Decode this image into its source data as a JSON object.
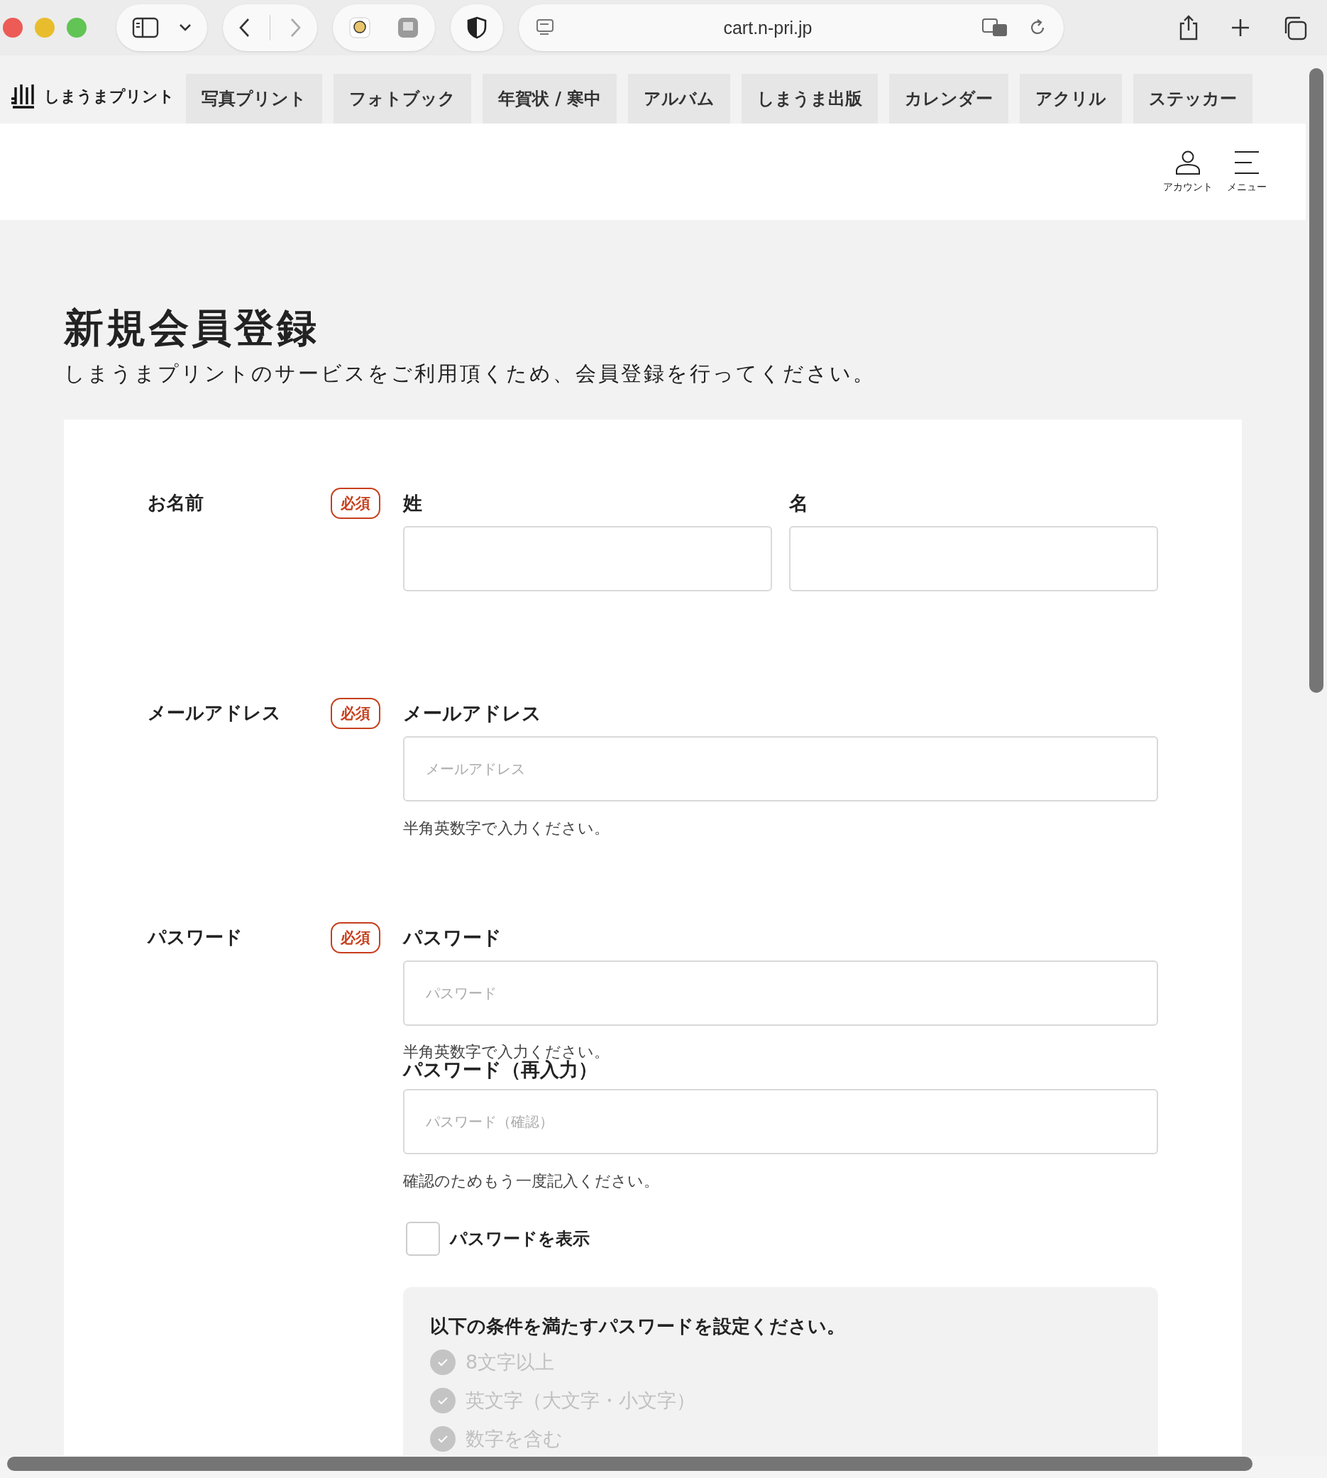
{
  "browser": {
    "url": "cart.n-pri.jp"
  },
  "site": {
    "logo": "しまうまプリント",
    "nav_tabs": [
      {
        "label": "写真プリント",
        "selected": false
      },
      {
        "label": "フォトブック",
        "selected": false
      },
      {
        "label": "年賀状 / 寒中",
        "selected": false
      },
      {
        "label": "アルバム",
        "selected": false
      },
      {
        "label": "しまうま出版",
        "selected": false
      },
      {
        "label": "カレンダー",
        "selected": false
      },
      {
        "label": "アクリル",
        "selected": false
      },
      {
        "label": "ステッカー",
        "selected": false
      }
    ],
    "header_actions": [
      {
        "kind": "account",
        "label": "アカウント"
      },
      {
        "kind": "menu",
        "label": "メニュー"
      }
    ]
  },
  "page": {
    "title": "新規会員登録",
    "subtitle": "しまうまプリントのサービスをご利用頂くため、会員登録を行ってください。"
  },
  "form": {
    "sections": [
      {
        "label": "お名前",
        "badge": "必須",
        "items": [
          {
            "kind": "pair",
            "fields": [
              {
                "label": "姓"
              },
              {
                "label": "名"
              }
            ]
          }
        ]
      },
      {
        "label": "メールアドレス",
        "badge": "必須",
        "items": [
          {
            "kind": "field",
            "label": "メールアドレス",
            "placeholder": "メールアドレス",
            "hint": "半角英数字で入力ください。"
          }
        ]
      },
      {
        "label": "パスワード",
        "badge": "必須",
        "items": [
          {
            "kind": "field",
            "label": "パスワード",
            "placeholder": "パスワード",
            "hint": "半角英数字で入力ください。"
          },
          {
            "kind": "field",
            "label": "パスワード（再入力）",
            "placeholder": "パスワード（確認）",
            "hint": "確認のためもう一度記入ください。"
          },
          {
            "kind": "checkbox",
            "label": "パスワードを表示",
            "checked": false
          },
          {
            "kind": "rules",
            "title": "以下の条件を満たすパスワードを設定ください。",
            "rules": [
              {
                "text": "8文字以上",
                "met": false
              },
              {
                "text": "英文字（大文字・小文字）",
                "met": false
              },
              {
                "text": "数字を含む",
                "met": false
              }
            ]
          }
        ]
      }
    ]
  }
}
